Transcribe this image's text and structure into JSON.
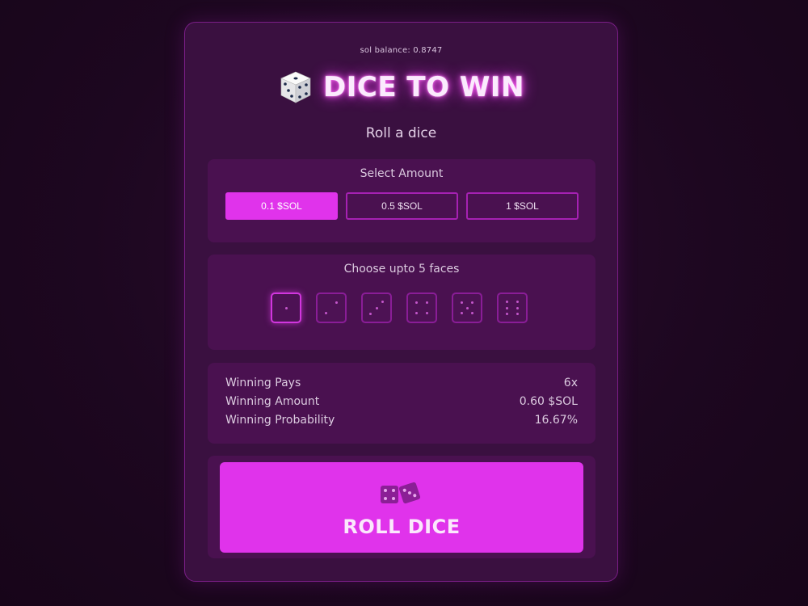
{
  "balance": "sol balance: 0.8747",
  "title": "DICE TO WIN",
  "subtitle": "Roll a dice",
  "amount": {
    "label": "Select Amount",
    "options": [
      "0.1 $SOL",
      "0.5 $SOL",
      "1 $SOL"
    ],
    "selected": "0.1 $SOL"
  },
  "faces": {
    "label": "Choose upto 5 faces",
    "values": [
      1,
      2,
      3,
      4,
      5,
      6
    ],
    "selected": [
      1
    ]
  },
  "stats": [
    {
      "label": "Winning Pays",
      "value": "6x"
    },
    {
      "label": "Winning Amount",
      "value": "0.60 $SOL"
    },
    {
      "label": "Winning Probability",
      "value": "16.67%"
    }
  ],
  "roll_button": {
    "label": "ROLL DICE",
    "icon": "dice-pair-icon"
  },
  "colors": {
    "accent": "#e033eb",
    "card": "#3a1040",
    "panel": "#4a1150",
    "background": "#1d0720"
  }
}
